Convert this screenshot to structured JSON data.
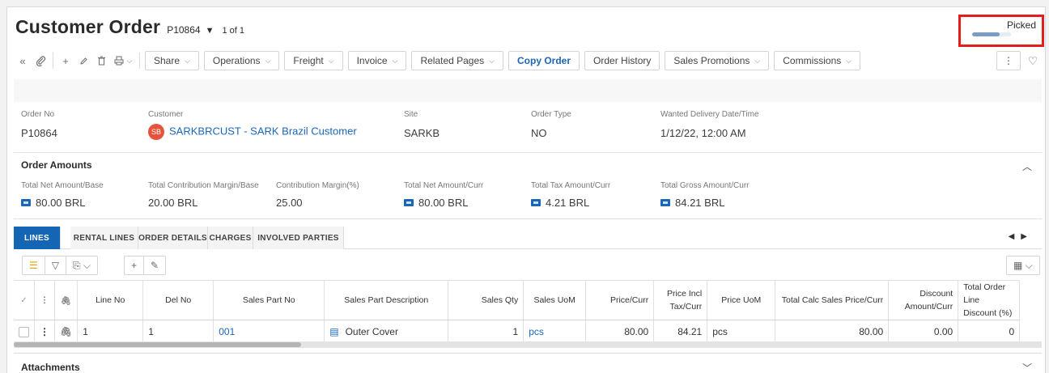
{
  "header": {
    "title": "Customer Order",
    "order_ref": "P10864",
    "caret": "▼",
    "record_count": "1 of 1"
  },
  "status": {
    "label": "Picked",
    "progress": 0.7
  },
  "toolbar": {
    "icons": {
      "collapse": "«",
      "attach": "🖇",
      "add": "+",
      "edit": "✎",
      "delete": "🗑",
      "print": "⎙",
      "more": "⋮",
      "favorite": "♡"
    },
    "buttons": [
      "Share",
      "Operations",
      "Freight",
      "Invoice",
      "Related Pages",
      "Copy Order",
      "Order History",
      "Sales Promotions",
      "Commissions"
    ]
  },
  "order": {
    "order_no_label": "Order No",
    "order_no": "P10864",
    "customer_label": "Customer",
    "customer_initials": "SB",
    "customer": "SARKBRCUST - SARK Brazil Customer",
    "site_label": "Site",
    "site": "SARKB",
    "order_type_label": "Order Type",
    "order_type": "NO",
    "delivery_label": "Wanted Delivery Date/Time",
    "delivery": "1/12/22, 12:00 AM"
  },
  "amounts": {
    "title": "Order Amounts",
    "items": [
      {
        "label": "Total Net Amount/Base",
        "value": "80.00 BRL"
      },
      {
        "label": "Total Contribution Margin/Base",
        "value": "20.00 BRL"
      },
      {
        "label": "Contribution Margin(%)",
        "value": "25.00"
      },
      {
        "label": "Total Net Amount/Curr",
        "value": "80.00 BRL"
      },
      {
        "label": "Total Tax Amount/Curr",
        "value": "4.21 BRL"
      },
      {
        "label": "Total Gross Amount/Curr",
        "value": "84.21 BRL"
      }
    ]
  },
  "tabs": [
    "LINES",
    "RENTAL LINES",
    "ORDER DETAILS",
    "CHARGES",
    "INVOLVED PARTIES"
  ],
  "table": {
    "headers": [
      "Line No",
      "Del No",
      "Sales Part No",
      "Sales Part Description",
      "Sales Qty",
      "Sales UoM",
      "Price/Curr",
      "Price Incl Tax/Curr",
      "Price UoM",
      "Total Calc Sales Price/Curr",
      "Discount Amount/Curr",
      "Total Order Line Discount (%)"
    ],
    "rows": [
      {
        "line_no": "1",
        "del_no": "1",
        "part_no": "001",
        "description": "Outer Cover",
        "qty": "1",
        "uom": "pcs",
        "price": "80.00",
        "price_incl": "84.21",
        "price_uom": "pcs",
        "total_calc": "80.00",
        "discount": "0.00",
        "line_discount": "0"
      }
    ]
  },
  "attachments": {
    "title": "Attachments"
  },
  "colors": {
    "accent": "#1565b5",
    "highlight": "#e31c1c",
    "avatar": "#e5533d"
  }
}
